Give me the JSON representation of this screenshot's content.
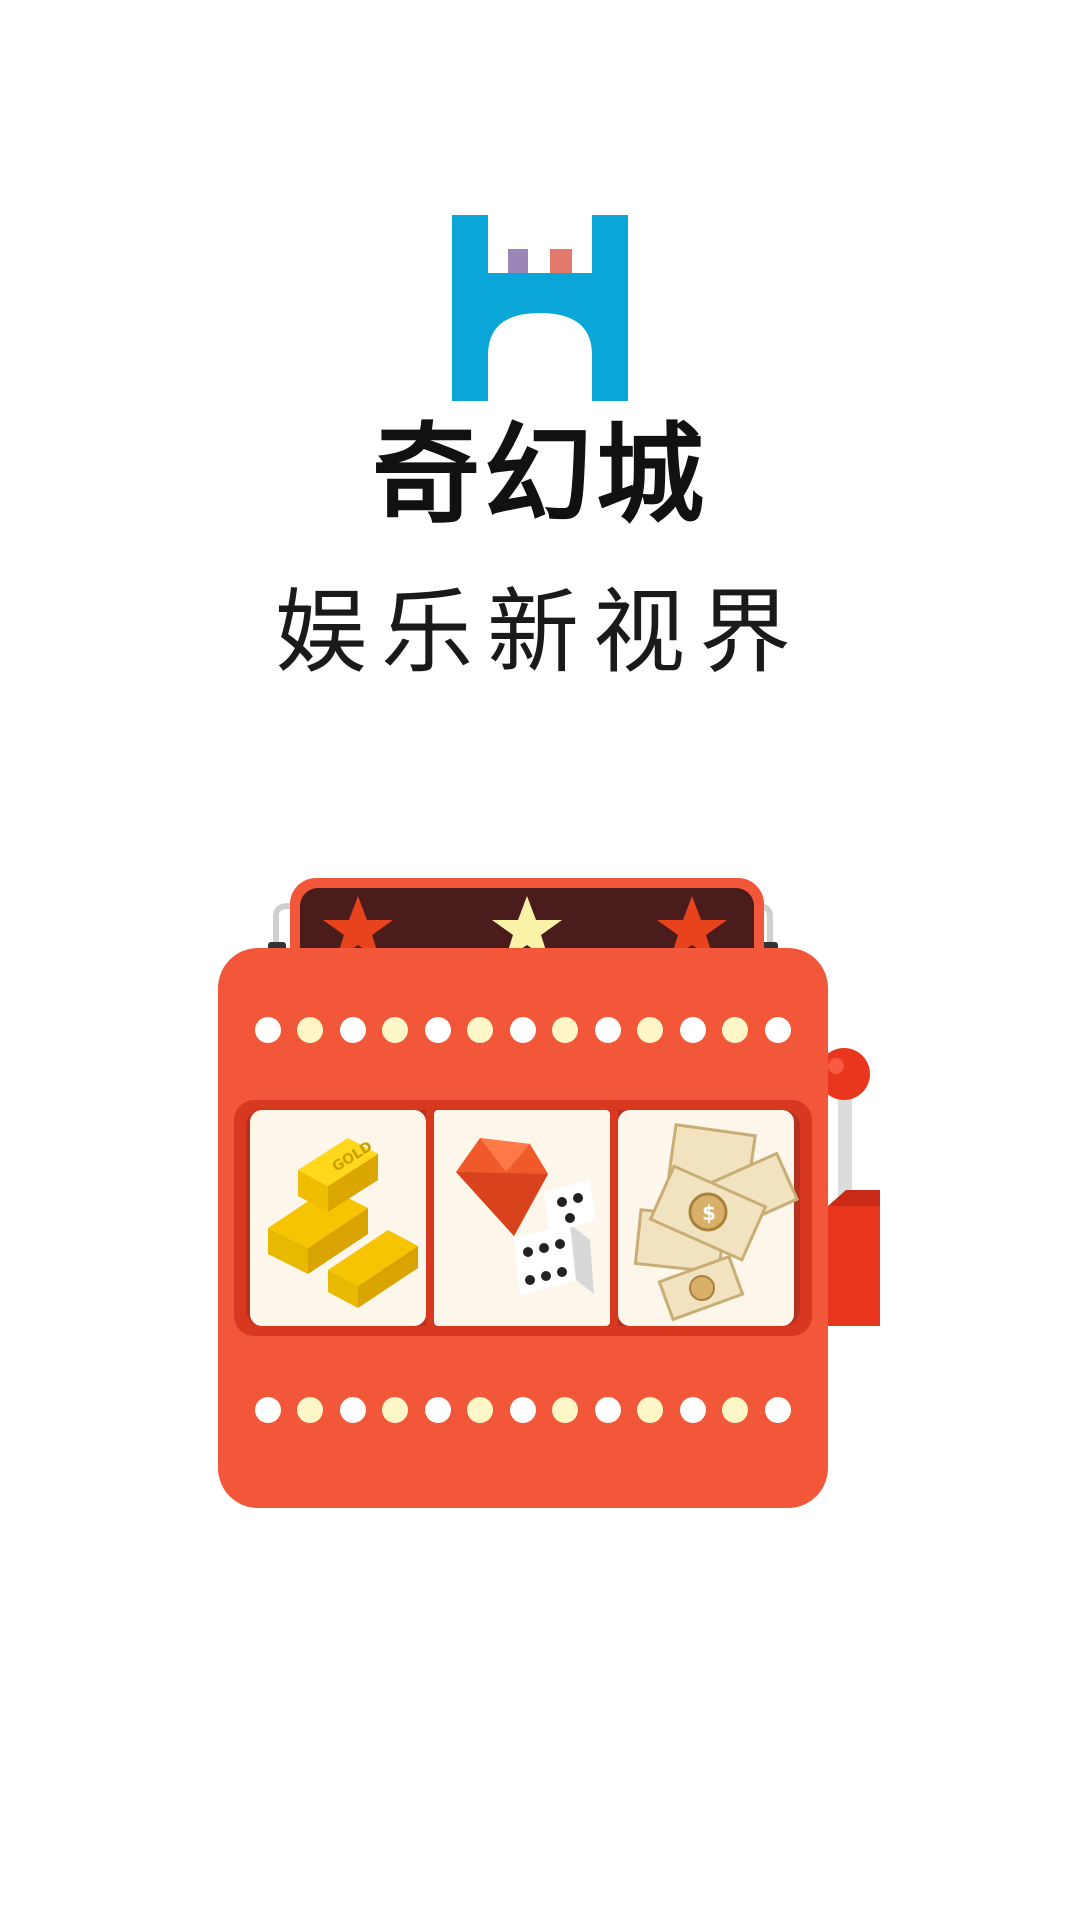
{
  "app": {
    "brand_name": "奇幻城",
    "tagline": "娱乐新视界"
  },
  "logo": {
    "icon": "castle-logo-icon",
    "colors": {
      "primary": "#0aa6d8",
      "tower_left": "#9a86b8",
      "tower_right": "#e27a6c"
    }
  },
  "illustration": {
    "icon": "slot-machine-icon",
    "stars": [
      "star-icon",
      "star-icon",
      "star-icon"
    ],
    "reels": [
      "gold-bars-icon",
      "gem-and-dice-icon",
      "dollar-bills-icon"
    ],
    "colors": {
      "body": "#f2573a",
      "marquee": "#4a1c1c",
      "star_red": "#e8431c",
      "star_yellow": "#fbf3a8",
      "light_bulb": "#fff6c8",
      "reel_bg": "#fcf7ea",
      "lever_knob": "#e8361f"
    }
  }
}
